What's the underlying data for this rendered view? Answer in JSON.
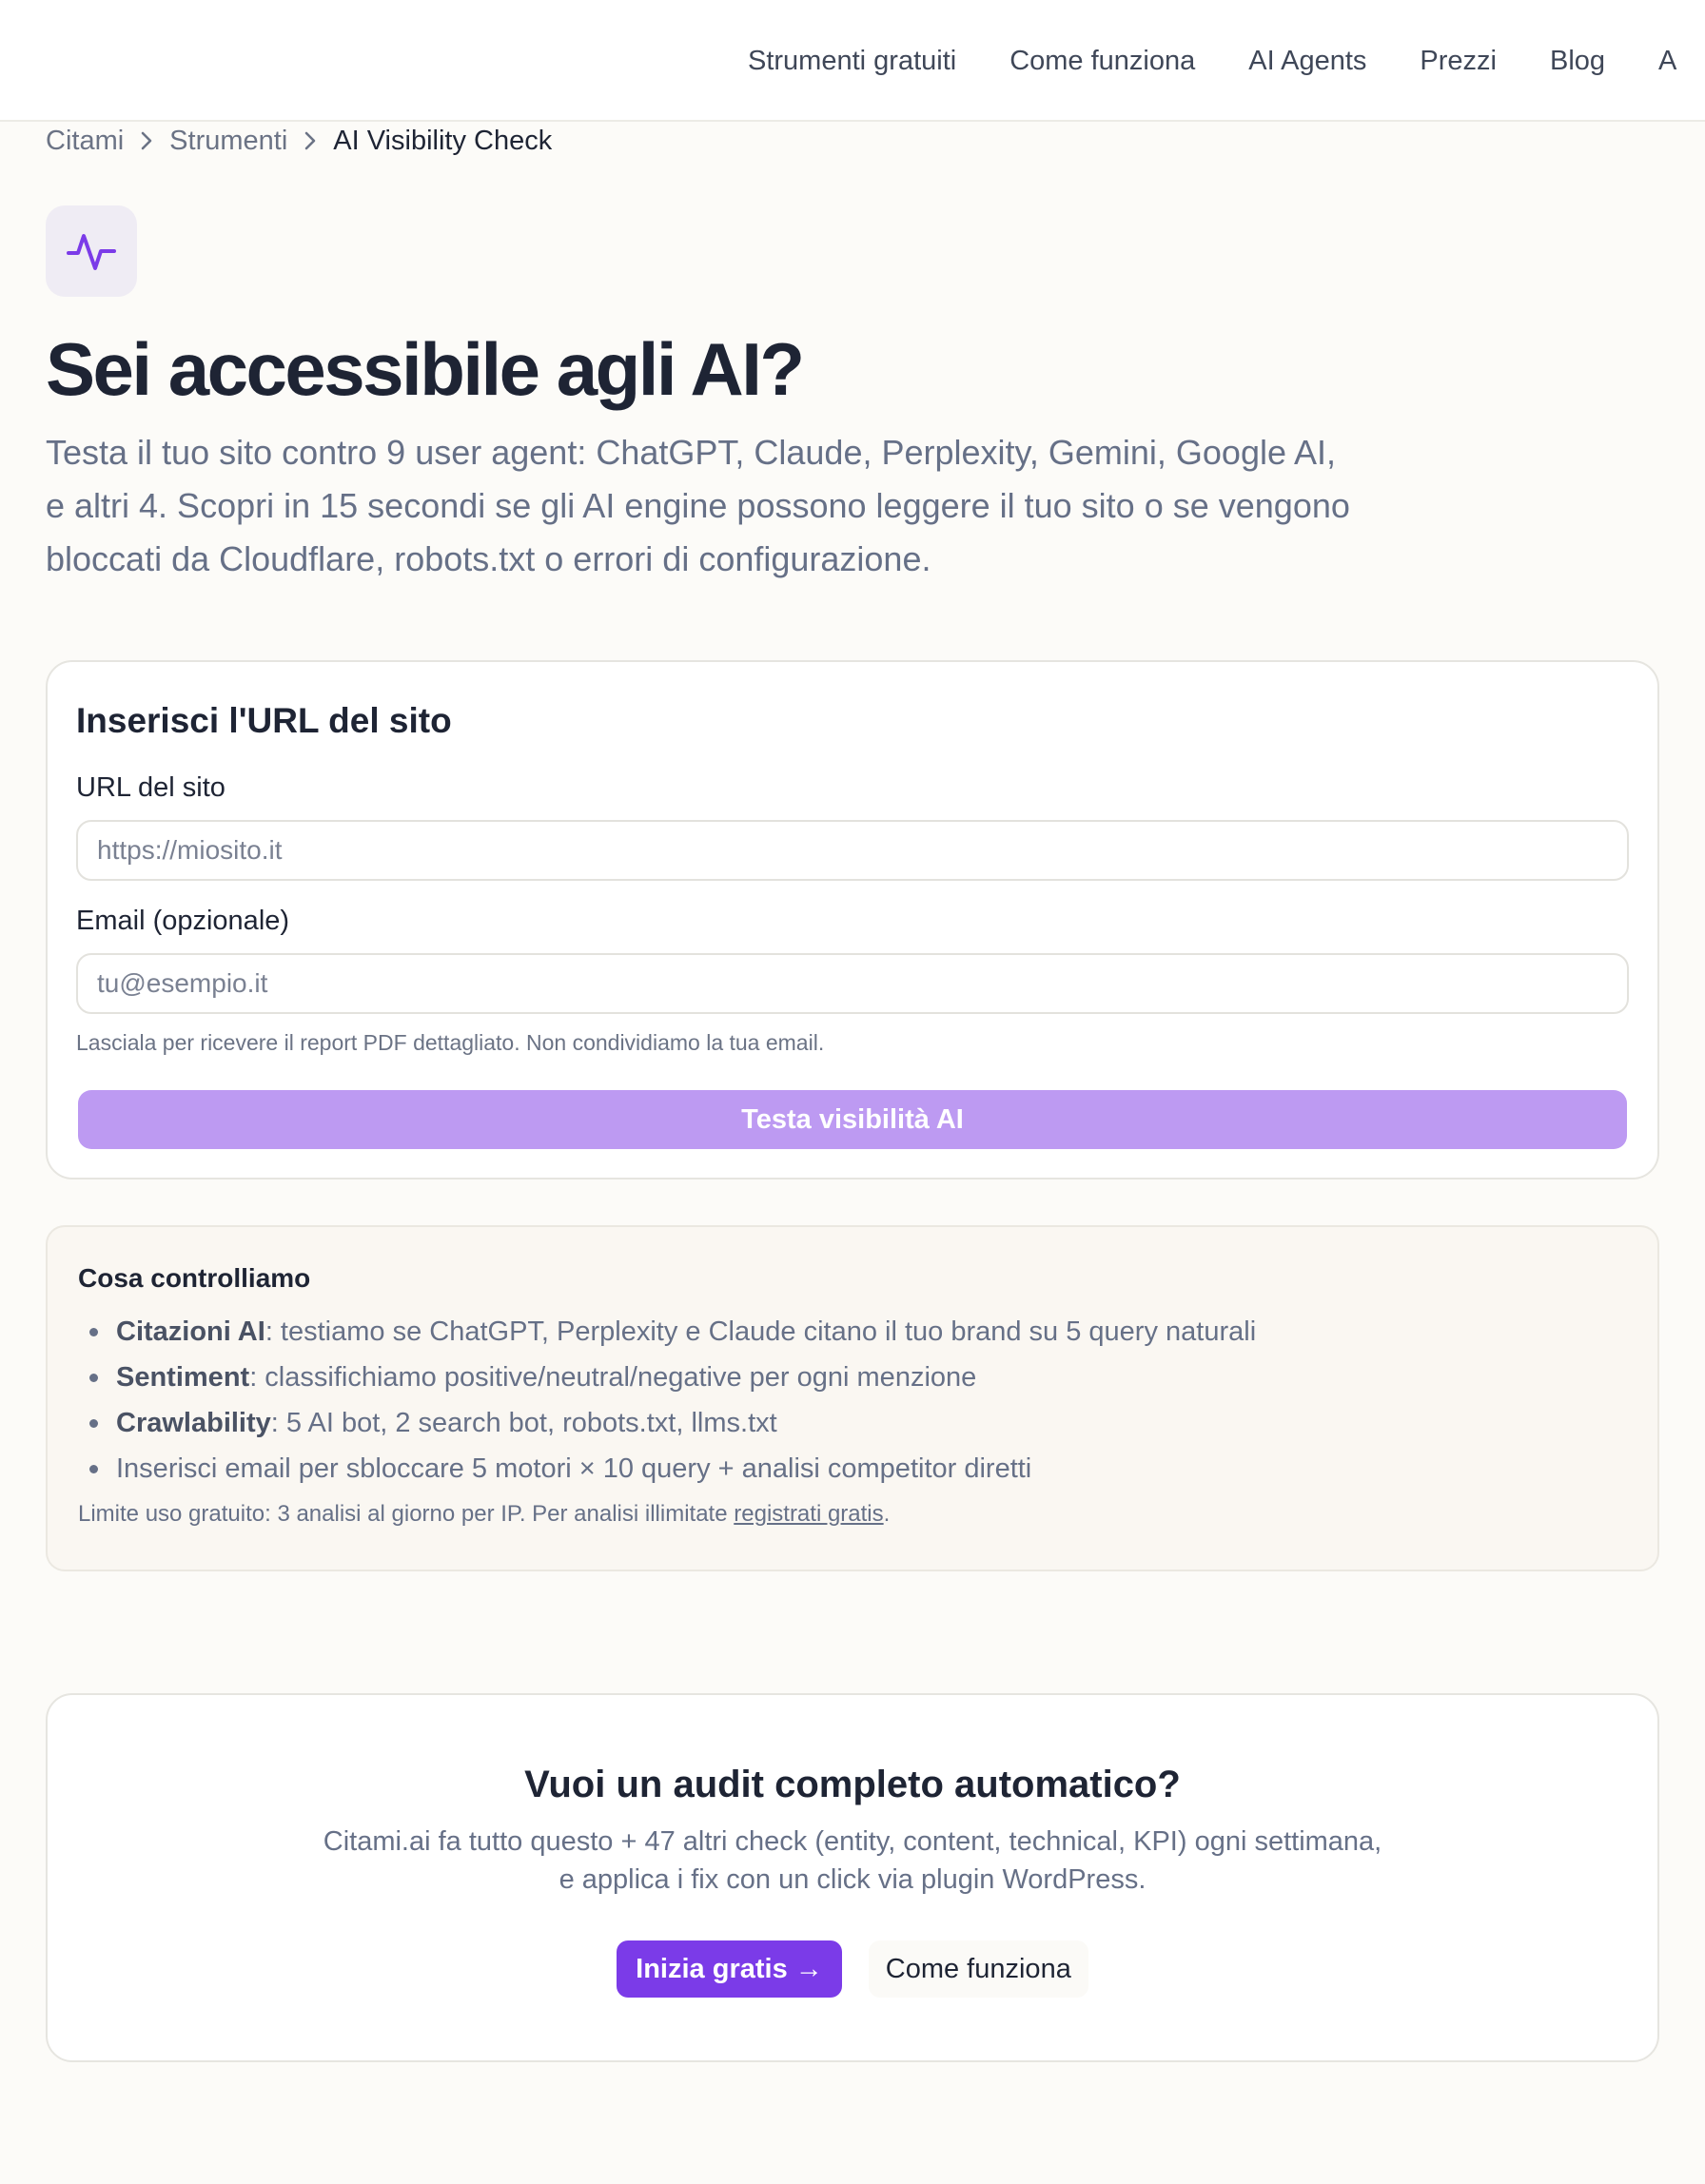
{
  "nav": {
    "items": [
      {
        "label": "Strumenti gratuiti"
      },
      {
        "label": "Come funziona"
      },
      {
        "label": "AI Agents"
      },
      {
        "label": "Prezzi"
      },
      {
        "label": "Blog"
      },
      {
        "label": "A"
      }
    ]
  },
  "breadcrumb": {
    "items": [
      {
        "label": "Citami"
      },
      {
        "label": "Strumenti"
      }
    ],
    "current": "AI Visibility Check"
  },
  "hero": {
    "icon": "activity-pulse-icon",
    "title": "Sei accessibile agli AI?",
    "subtitle": "Testa il tuo sito contro 9 user agent: ChatGPT, Claude, Perplexity, Gemini, Google AI, e altri 4. Scopri in 15 secondi se gli AI engine possono leggere il tuo sito o se vengono bloccati da Cloudflare, robots.txt o errori di configurazione."
  },
  "form": {
    "title": "Inserisci l'URL del sito",
    "url_label": "URL del sito",
    "url_placeholder": "https://miosito.it",
    "email_label": "Email (opzionale)",
    "email_placeholder": "tu@esempio.it",
    "help_text": "Lasciala per ricevere il report PDF dettagliato. Non condividiamo la tua email.",
    "submit_label": "Testa visibilità AI"
  },
  "info": {
    "title": "Cosa controlliamo",
    "items": [
      {
        "bold": "Citazioni AI",
        "text": ": testiamo se ChatGPT, Perplexity e Claude citano il tuo brand su 5 query naturali"
      },
      {
        "bold": "Sentiment",
        "text": ": classifichiamo positive/neutral/negative per ogni menzione"
      },
      {
        "bold": "Crawlability",
        "text": ": 5 AI bot, 2 search bot, robots.txt, llms.txt"
      },
      {
        "bold": "",
        "text": "Inserisci email per sbloccare 5 motori × 10 query + analisi competitor diretti"
      }
    ],
    "limit_prefix": "Limite uso gratuito: 3 analisi al giorno per IP. Per analisi illimitate ",
    "limit_link": "registrati gratis",
    "limit_suffix": "."
  },
  "cta": {
    "title": "Vuoi un audit completo automatico?",
    "text_line1": "Citami.ai fa tutto questo + 47 altri check (entity, content, technical, KPI) ogni settimana,",
    "text_line2": "e applica i fix con un click via plugin WordPress.",
    "primary_label": "Inizia gratis →",
    "secondary_label": "Come funziona"
  },
  "colors": {
    "accent": "#7b3be8",
    "accent_light": "#bd9af2",
    "text_dark": "#1e2434",
    "text_muted": "#667087",
    "background": "#fcfbf8"
  }
}
